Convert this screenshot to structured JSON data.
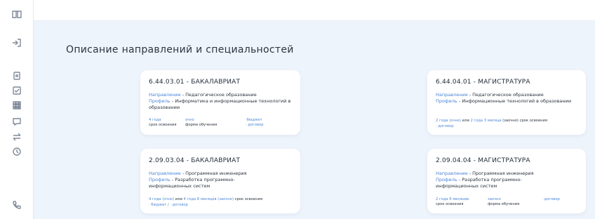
{
  "page": {
    "title": "Описание направлений и специальностей"
  },
  "sidebar": {
    "icons": [
      "book-icon",
      "login-icon",
      "document-icon",
      "checklist-icon",
      "grid-icon",
      "chat-icon",
      "transfer-icon",
      "history-icon",
      "phone-icon"
    ]
  },
  "cards": [
    {
      "title": "6.44.03.01 - БАКАЛАВРИАТ",
      "direction_label": "Направление",
      "direction_value": " - Педагогическое образование",
      "profile_label": "Профиль",
      "profile_value": " - Информатика и информационные технологий в образовании",
      "meta": {
        "duration": "4 года",
        "duration_caption": "срок освоения",
        "form": "очно",
        "form_caption": "форма обучения",
        "budget": "·бюджет",
        "contract": "· договор"
      }
    },
    {
      "title": "6.44.04.01 - МАГИСТРАТУРА",
      "direction_label": "Направление",
      "direction_value": " - Педагогическое образование",
      "profile_label": "Профиль",
      "profile_value": " - Информационные технологий в образовании",
      "meta_line": {
        "part1": "2 года (очно)",
        "or": " или ",
        "part2": "2 года 3 месяца",
        "tail": " (заочно) срок освоения",
        "contract": "· договор"
      }
    },
    {
      "title": "2.09.03.04 - БАКАЛАВРИАТ",
      "direction_label": "Направление",
      "direction_value": " - Программная инженерия",
      "profile_label": "Профиль",
      "profile_value": " - Разработка программно-информационных систем",
      "meta_line": {
        "part1": "4 года (очно)",
        "or": " или ",
        "part2": "4 года 8 месяцев (заочно)",
        "tail": " срок освоения",
        "contract": "· бюджет / · договор"
      }
    },
    {
      "title": "2.09.04.04 - МАГИСТРАТУРА",
      "direction_label": "Направление",
      "direction_value": " - Программная инженерия",
      "profile_label": "Профиль",
      "profile_value": " - Разработка программно-информационных систем",
      "meta": {
        "duration": "2 года 6 месяцев",
        "duration_caption": "срок освоения",
        "form": "заочно",
        "form_caption": "форма обучения",
        "contract": "·договор"
      }
    }
  ]
}
